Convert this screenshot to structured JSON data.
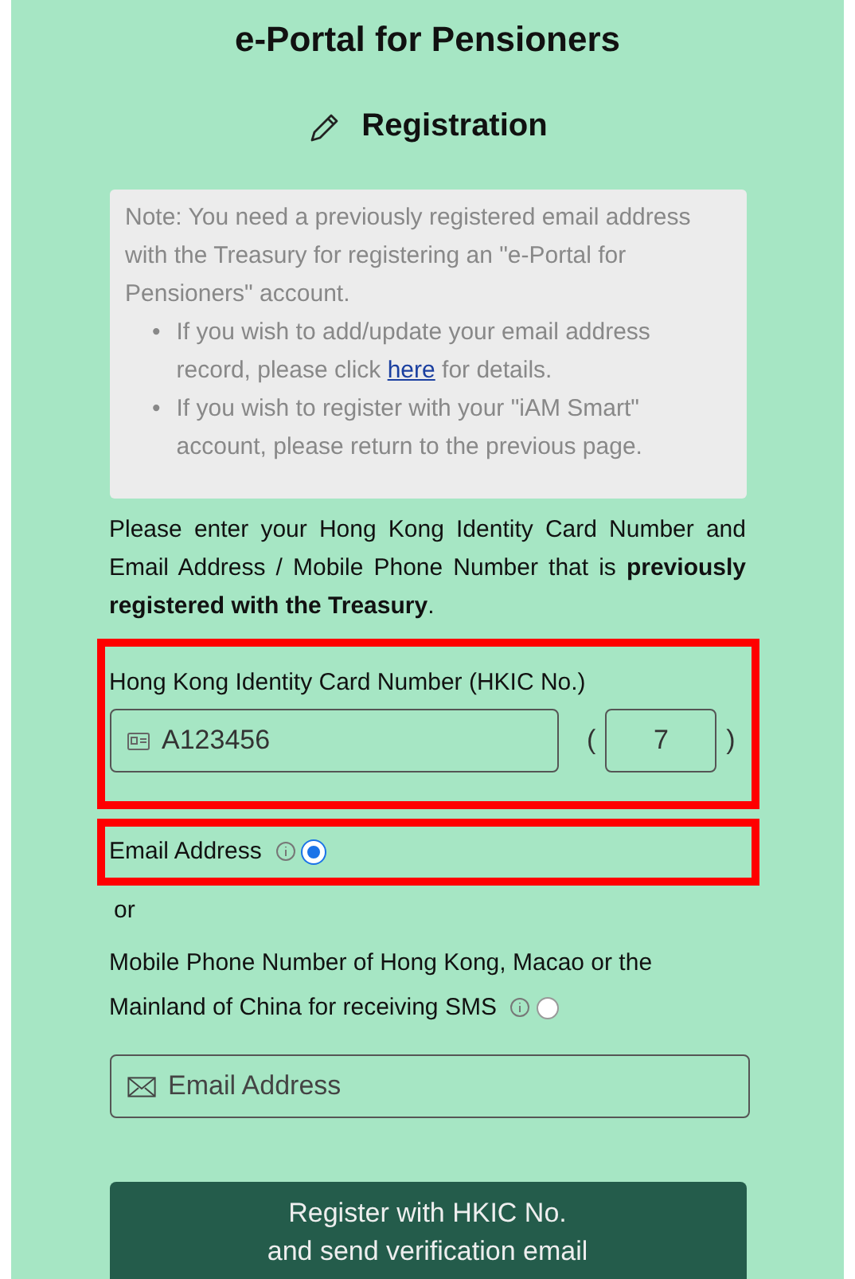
{
  "title": "e-Portal for Pensioners",
  "heading": "Registration",
  "note": {
    "text": "Note: You need a previously registered email address with the Treasury for registering an \"e-Portal for Pensioners\" account.",
    "bullets": [
      {
        "marker": "•",
        "before": "If you wish to add/update your email address record, please click ",
        "link": "here",
        "after": " for details."
      },
      {
        "marker": "•",
        "before": "If you wish to register with your \"iAM Smart\" account, please return to the previous page."
      }
    ]
  },
  "instruction": "Please enter your Hong Kong Identity Card Number and Email Address / Mobile Phone Number that is **previously registered with the Treasury**.",
  "hkic": {
    "label": "Hong Kong Identity Card Number (HKIC No.)",
    "highlighted": true,
    "number": "A123456",
    "open_paren": "(",
    "check_digit": "7",
    "close_paren": ")"
  },
  "contact_options": [
    {
      "label": "Email Address",
      "selected": true,
      "highlighted": true
    },
    {
      "label": "Mobile Phone Number of Hong Kong, Macao or the Mainland of China for receiving SMS",
      "selected": false,
      "highlighted": false
    }
  ],
  "or_text": "or",
  "contact_field": {
    "placeholder": "Email Address"
  },
  "submit": {
    "lines": [
      "Register with HKIC No.",
      "and send verification email"
    ]
  }
}
